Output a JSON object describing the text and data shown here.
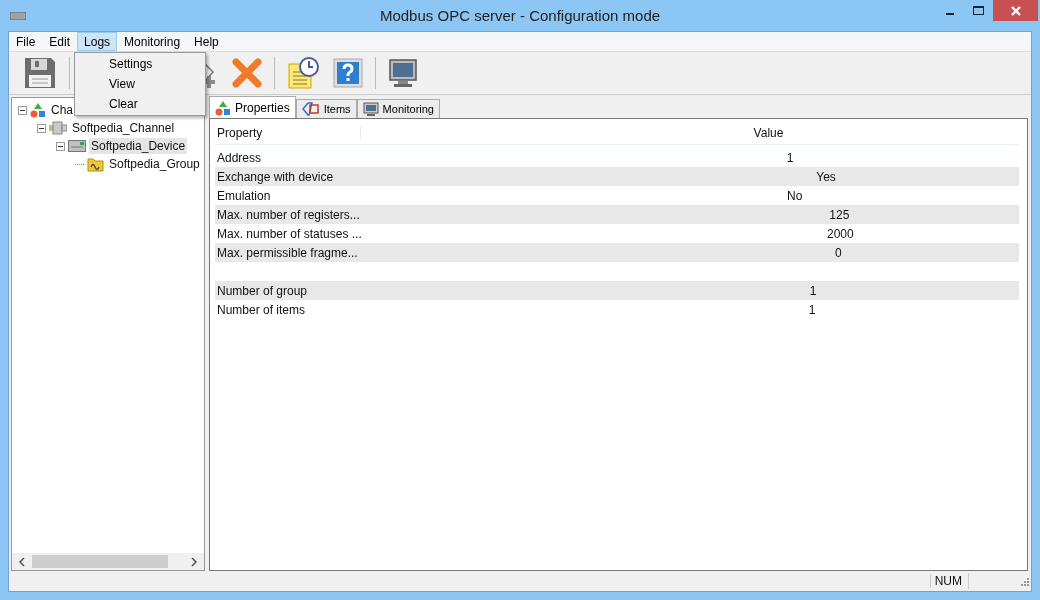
{
  "window": {
    "title": "Modbus OPC server - Configuration mode"
  },
  "menu": [
    {
      "label": "File",
      "selected": false
    },
    {
      "label": "Edit",
      "selected": false
    },
    {
      "label": "Logs",
      "selected": true
    },
    {
      "label": "Monitoring",
      "selected": false
    },
    {
      "label": "Help",
      "selected": false
    }
  ],
  "logs_menu": [
    "Settings",
    "View",
    "Clear"
  ],
  "tree": [
    {
      "label": "Cha",
      "kind": "root",
      "selected": false,
      "children": [
        {
          "label": "Softpedia_Channel",
          "kind": "channel",
          "selected": false,
          "children": [
            {
              "label": "Softpedia_Device",
              "kind": "device",
              "selected": true,
              "children": [
                {
                  "label": "Softpedia_Group",
                  "kind": "group",
                  "selected": false
                }
              ]
            }
          ]
        }
      ]
    }
  ],
  "tabs": [
    {
      "label": "Properties",
      "kind": "properties",
      "selected": true
    },
    {
      "label": "Items",
      "kind": "items",
      "selected": false
    },
    {
      "label": "Monitoring",
      "kind": "monitoring",
      "selected": false
    }
  ],
  "table": {
    "columns": [
      "Property",
      "Value"
    ],
    "rows": [
      {
        "kind": "data",
        "property": "Address",
        "value": "1"
      },
      {
        "kind": "data",
        "property": "Exchange with device",
        "value": "Yes"
      },
      {
        "kind": "data",
        "property": "Emulation",
        "value": "No"
      },
      {
        "kind": "data",
        "property": "Max. number of registers...",
        "value": "125"
      },
      {
        "kind": "data",
        "property": "Max. number of statuses ...",
        "value": "2000"
      },
      {
        "kind": "data",
        "property": "Max. permissible fragme...",
        "value": "0"
      },
      {
        "kind": "spacer"
      },
      {
        "kind": "data",
        "property": "Number of group",
        "value": "1"
      },
      {
        "kind": "data",
        "property": "Number of items",
        "value": "1"
      }
    ]
  },
  "status_bar": {
    "indicator": "NUM"
  }
}
